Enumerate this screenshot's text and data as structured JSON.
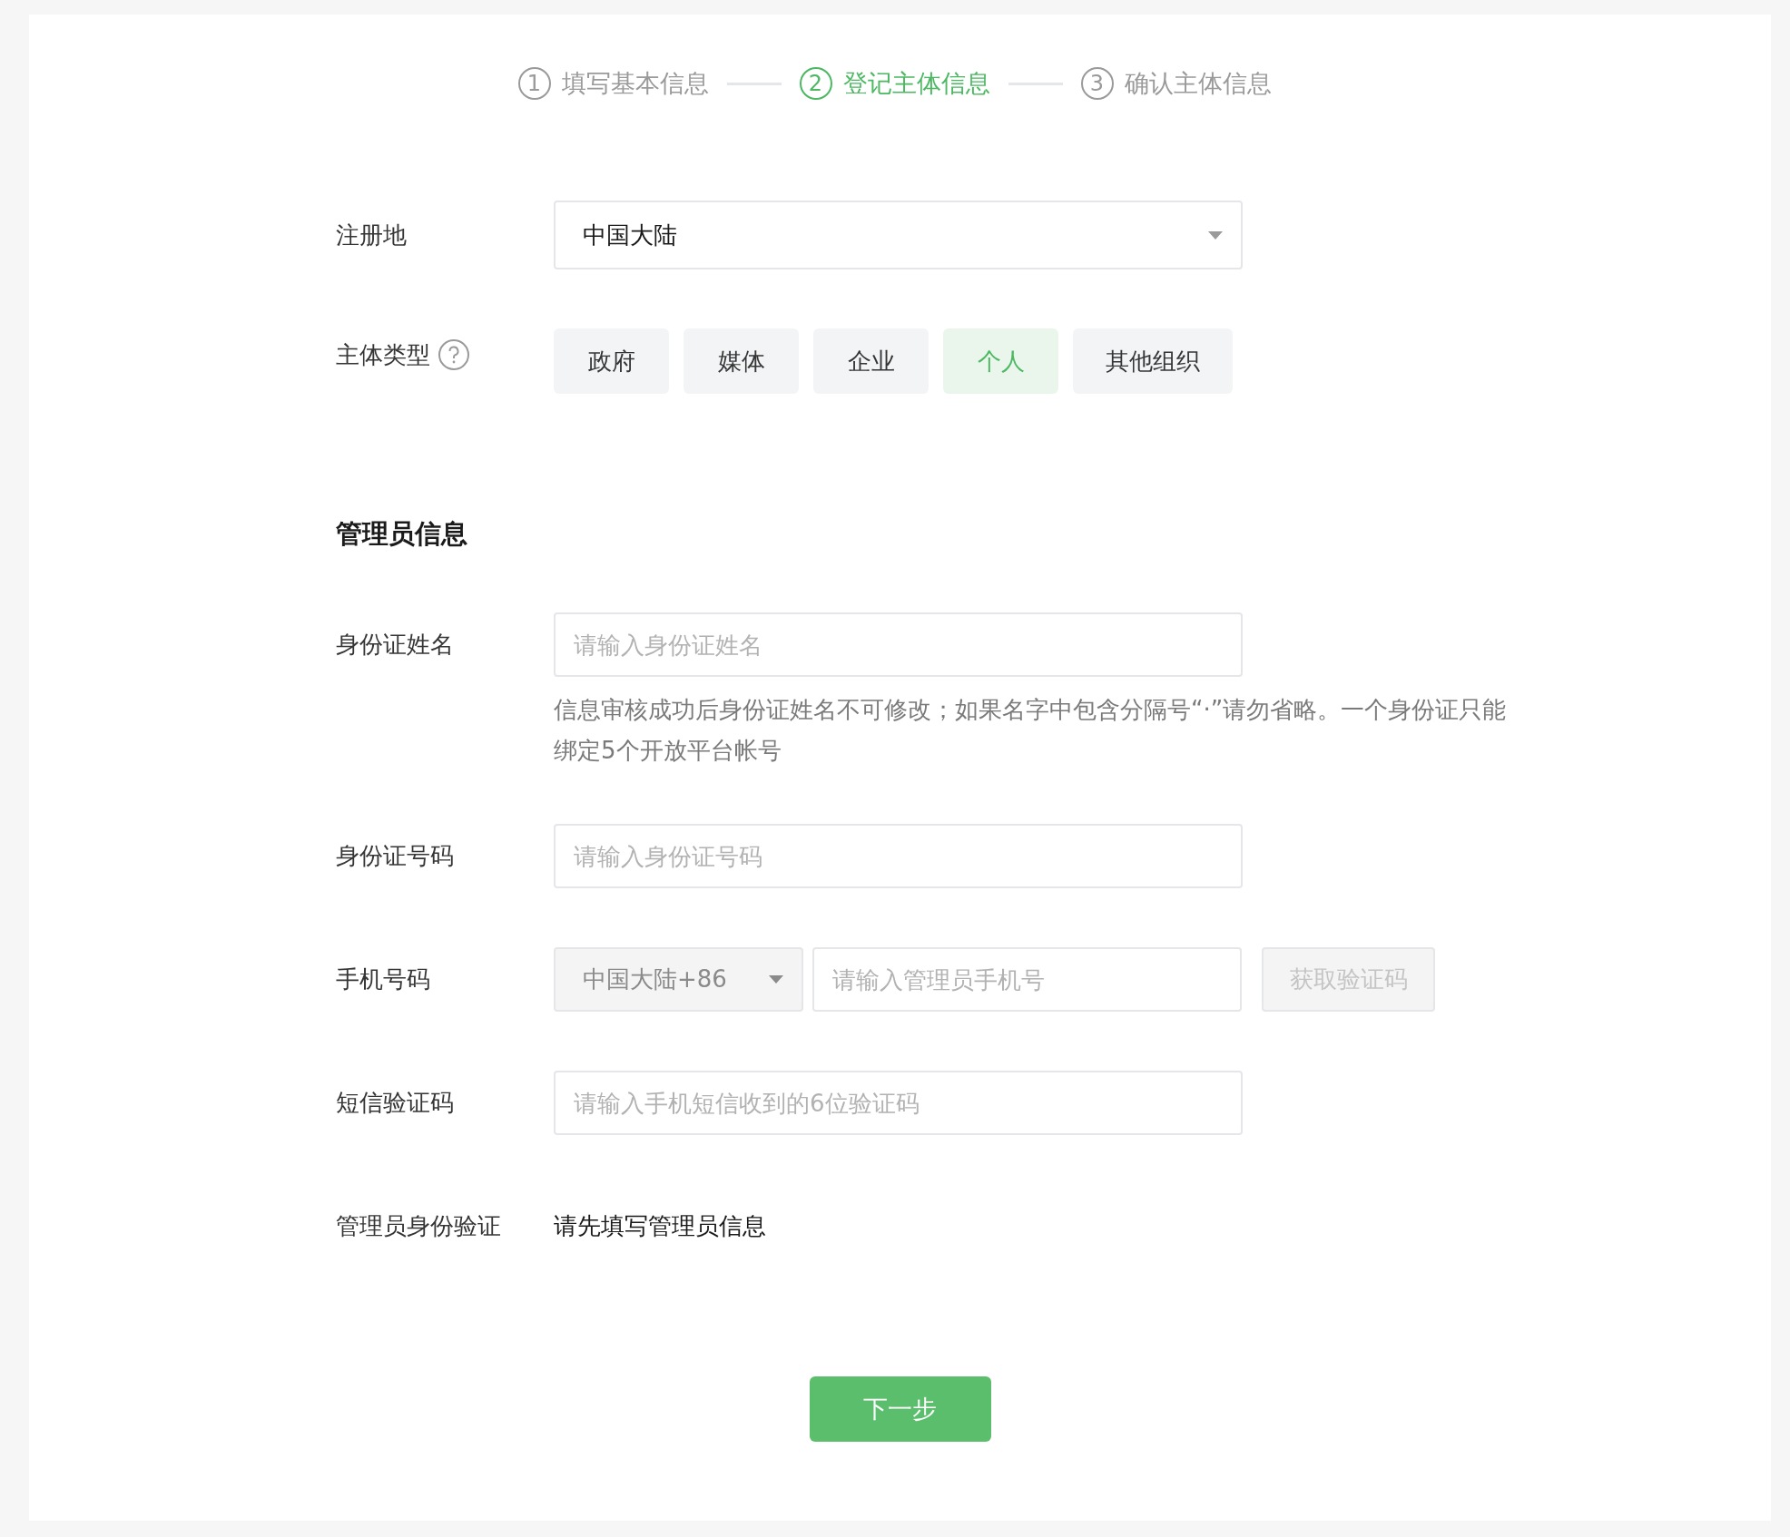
{
  "steps": [
    {
      "number": "1",
      "label": "填写基本信息",
      "selected": false
    },
    {
      "number": "2",
      "label": "登记主体信息",
      "selected": true
    },
    {
      "number": "3",
      "label": "确认主体信息",
      "selected": false
    }
  ],
  "region": {
    "label": "注册地",
    "value": "中国大陆"
  },
  "entity_type": {
    "label": "主体类型",
    "options": [
      {
        "label": "政府",
        "selected": false
      },
      {
        "label": "媒体",
        "selected": false
      },
      {
        "label": "企业",
        "selected": false
      },
      {
        "label": "个人",
        "selected": true
      },
      {
        "label": "其他组织",
        "selected": false
      }
    ]
  },
  "admin_section": {
    "title": "管理员信息"
  },
  "id_name": {
    "label": "身份证姓名",
    "placeholder": "请输入身份证姓名",
    "hint": "信息审核成功后身份证姓名不可修改；如果名字中包含分隔号“·”请勿省略。一个身份证只能绑定5个开放平台帐号"
  },
  "id_number": {
    "label": "身份证号码",
    "placeholder": "请输入身份证号码"
  },
  "phone": {
    "label": "手机号码",
    "country_code": "中国大陆+86",
    "placeholder": "请输入管理员手机号",
    "send_code_button": {
      "label": "获取验证码",
      "disabled": true
    }
  },
  "sms_code": {
    "label": "短信验证码",
    "placeholder": "请输入手机短信收到的6位验证码"
  },
  "admin_verification": {
    "label": "管理员身份验证",
    "value": "请先填写管理员信息"
  },
  "next_button": "下一步"
}
